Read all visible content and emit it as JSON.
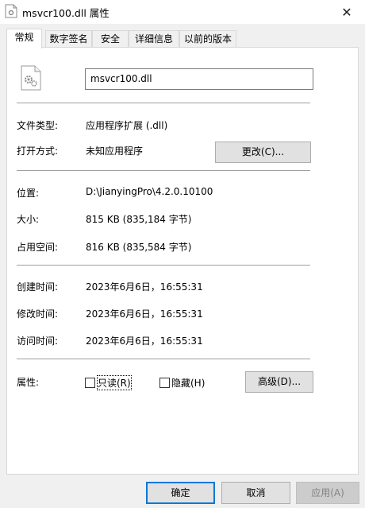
{
  "window": {
    "title": "msvcr100.dll 属性",
    "close_glyph": "✕"
  },
  "tabs": [
    {
      "label": "常规",
      "active": true
    },
    {
      "label": "数字签名"
    },
    {
      "label": "安全"
    },
    {
      "label": "详细信息"
    },
    {
      "label": "以前的版本"
    }
  ],
  "general": {
    "file_name": "msvcr100.dll",
    "file_type_label": "文件类型:",
    "file_type_value": "应用程序扩展 (.dll)",
    "opens_with_label": "打开方式:",
    "opens_with_value": "未知应用程序",
    "change_button": "更改(C)...",
    "location_label": "位置:",
    "location_value": "D:\\JianyingPro\\4.2.0.10100",
    "size_label": "大小:",
    "size_value": "815 KB (835,184 字节)",
    "size_on_disk_label": "占用空间:",
    "size_on_disk_value": "816 KB (835,584 字节)",
    "created_label": "创建时间:",
    "created_value": "2023年6月6日，16:55:31",
    "modified_label": "修改时间:",
    "modified_value": "2023年6月6日，16:55:31",
    "accessed_label": "访问时间:",
    "accessed_value": "2023年6月6日，16:55:31",
    "attributes_label": "属性:",
    "readonly_label": "只读(R)",
    "hidden_label": "隐藏(H)",
    "advanced_button": "高级(D)..."
  },
  "footer": {
    "ok": "确定",
    "cancel": "取消",
    "apply": "应用(A)"
  },
  "colors": {
    "accent": "#0078d7",
    "window_bg": "#f0f0f0",
    "panel_bg": "#ffffff"
  }
}
